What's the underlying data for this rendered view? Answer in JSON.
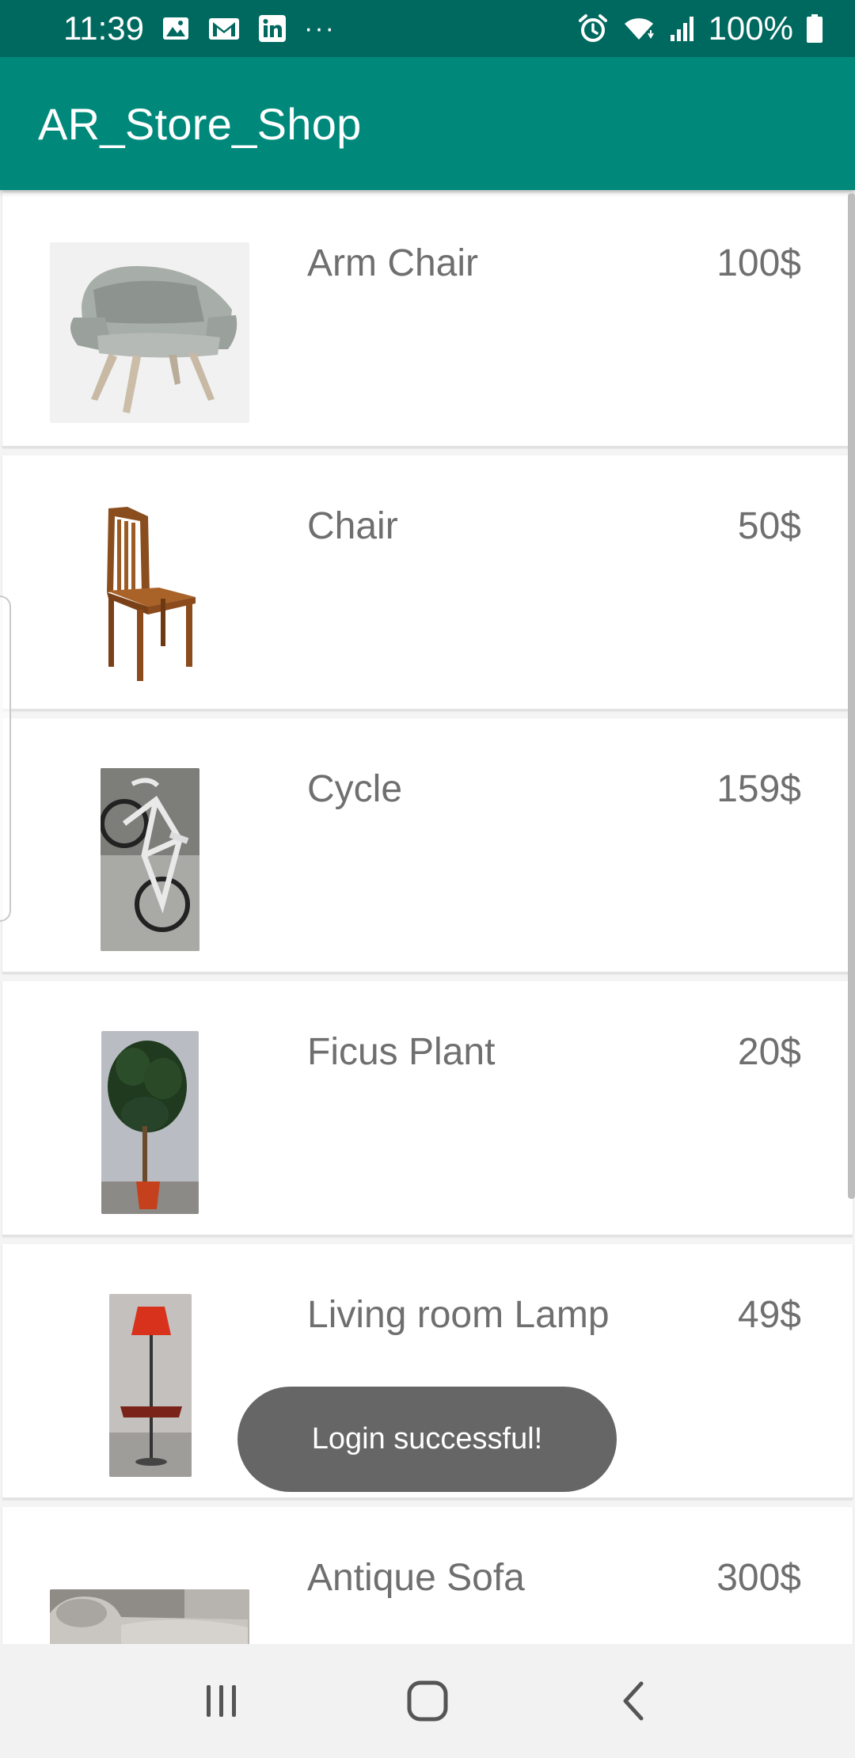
{
  "status_bar": {
    "time": "11:39",
    "more": "···",
    "battery": "100%",
    "left_icons": [
      "gallery-icon",
      "gmail-icon",
      "linkedin-icon"
    ],
    "right_icons": [
      "alarm-icon",
      "wifi-icon",
      "signal-icon",
      "battery-icon"
    ]
  },
  "app_bar": {
    "title": "AR_Store_Shop",
    "color": "#00897b",
    "status_color": "#00695f"
  },
  "products": [
    {
      "name": "Arm Chair",
      "price": "100$",
      "image": "arm-chair-image"
    },
    {
      "name": "Chair",
      "price": "50$",
      "image": "chair-image"
    },
    {
      "name": "Cycle",
      "price": "159$",
      "image": "cycle-image"
    },
    {
      "name": "Ficus Plant",
      "price": "20$",
      "image": "ficus-plant-image"
    },
    {
      "name": "Living room Lamp",
      "price": "49$",
      "image": "lamp-image"
    },
    {
      "name": "Antique Sofa",
      "price": "300$",
      "image": "sofa-image"
    }
  ],
  "toast": {
    "message": "Login successful!"
  },
  "nav_bar": {
    "buttons": [
      "recents-icon",
      "home-icon",
      "back-icon"
    ]
  }
}
